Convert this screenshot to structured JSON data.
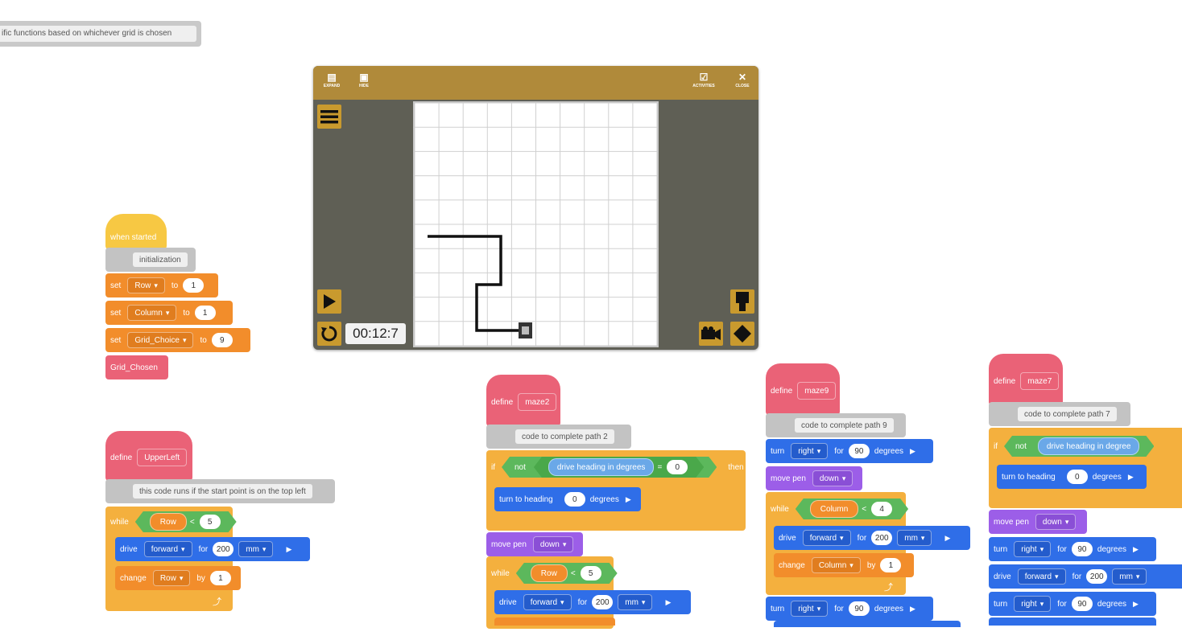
{
  "note": {
    "text": "ific functions based on whichever grid is chosen"
  },
  "simulator": {
    "toolbar": {
      "expand": "EXPAND",
      "hide": "HIDE",
      "activities": "ACTIVITIES",
      "close": "CLOSE"
    },
    "timer": "00:12:7",
    "icons": [
      "menu-icon",
      "play-icon",
      "reset-icon",
      "robot-view-icon",
      "camera-icon",
      "eraser-icon"
    ]
  },
  "script_main": {
    "hat": "when started",
    "comment": "initialization",
    "set_kw": "set",
    "to_kw": "to",
    "set1": {
      "var": "Row",
      "value": "1"
    },
    "set2": {
      "var": "Column",
      "value": "1"
    },
    "set3": {
      "var": "Grid_Choice",
      "value": "9"
    },
    "call": "Grid_Chosen"
  },
  "script_upperleft": {
    "define_kw": "define",
    "name": "UpperLeft",
    "comment": "this code runs if the start point is on the top left",
    "while_kw": "while",
    "cond_var": "Row",
    "cond_op": "<",
    "cond_val": "5",
    "drive_kw": "drive",
    "drive_dir": "forward",
    "for_kw": "for",
    "drive_dist": "200",
    "drive_unit": "mm",
    "change_kw": "change",
    "change_var": "Row",
    "by_kw": "by",
    "change_val": "1"
  },
  "script_maze2": {
    "define_kw": "define",
    "name": "maze2",
    "comment": "code to complete path 2",
    "if_kw": "if",
    "not_kw": "not",
    "reporter": "drive heading in degrees",
    "eq": "=",
    "eq_val": "0",
    "then_kw": "then",
    "turn_heading": "turn to heading",
    "heading_val": "0",
    "degrees": "degrees",
    "pen_kw": "move pen",
    "pen_val": "down",
    "while_kw": "while",
    "cond_var": "Row",
    "cond_op": "<",
    "cond_val": "5",
    "drive_kw": "drive",
    "drive_dir": "forward",
    "for_kw": "for",
    "drive_dist": "200",
    "drive_unit": "mm"
  },
  "script_maze9": {
    "define_kw": "define",
    "name": "maze9",
    "comment": "code to complete path 9",
    "turn_kw": "turn",
    "turn_dir": "right",
    "for_kw": "for",
    "turn_val": "90",
    "degrees": "degrees",
    "pen_kw": "move pen",
    "pen_val": "down",
    "while_kw": "while",
    "cond_var": "Column",
    "cond_op": "<",
    "cond_val": "4",
    "drive_kw": "drive",
    "drive_dir": "forward",
    "drive_dist": "200",
    "drive_unit": "mm",
    "change_kw": "change",
    "change_var": "Column",
    "by_kw": "by",
    "change_val": "1",
    "turn2_val": "90"
  },
  "script_maze7": {
    "define_kw": "define",
    "name": "maze7",
    "comment": "code to complete path 7",
    "if_kw": "if",
    "not_kw": "not",
    "reporter": "drive heading in degree",
    "turn_heading": "turn to heading",
    "heading_val": "0",
    "degrees": "degrees",
    "pen_kw": "move pen",
    "pen_val": "down",
    "turn_kw": "turn",
    "turn_dir": "right",
    "for_kw": "for",
    "turn_val": "90",
    "drive_kw": "drive",
    "drive_dir": "forward",
    "drive_dist": "200",
    "drive_unit": "mm",
    "turn2_val": "90"
  }
}
